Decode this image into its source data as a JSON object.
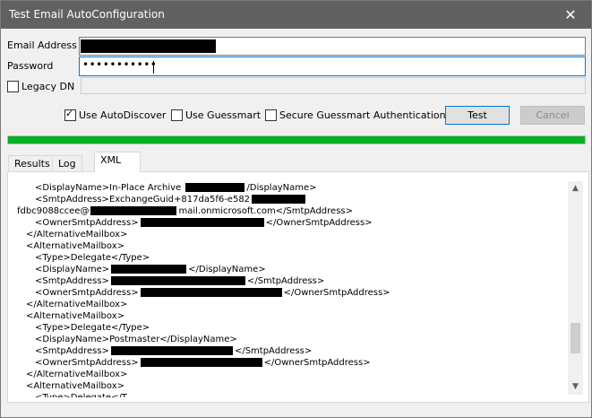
{
  "window": {
    "title": "Test Email AutoConfiguration",
    "close_glyph": "✕"
  },
  "form": {
    "email_label": "Email Address",
    "password_label": "Password",
    "password_value": "•••••••••••",
    "legacy_dn_label": "Legacy DN"
  },
  "options": {
    "use_autodiscover": {
      "label": "Use AutoDiscover",
      "checked": true
    },
    "use_guessmart": {
      "label": "Use Guessmart",
      "checked": false
    },
    "secure_guessmart": {
      "label": "Secure Guessmart Authentication",
      "checked": false
    }
  },
  "buttons": {
    "test": "Test",
    "cancel": "Cancel"
  },
  "progress": {
    "fraction": 1.0,
    "color": "#06b025"
  },
  "tabs": [
    {
      "label": "Results",
      "active": false
    },
    {
      "label": "Log",
      "active": false
    },
    {
      "label": "XML",
      "active": true
    }
  ],
  "xml_lines": [
    {
      "indent": 2,
      "before": "<DisplayName>In-Place Archive ",
      "after": "/DisplayName>"
    },
    {
      "indent": 2,
      "before": "<SmtpAddress>ExchangeGuid+817da5f6-e582",
      "after": ""
    },
    {
      "indent": 0,
      "before": "fdbc9088ccee@",
      "after": "mail.onmicrosoft.com</SmtpAddress>"
    },
    {
      "indent": 2,
      "before": "<OwnerSmtpAddress>",
      "after": "</OwnerSmtpAddress>"
    },
    {
      "indent": 1,
      "before": "</AlternativeMailbox>",
      "after": ""
    },
    {
      "indent": 1,
      "before": "<AlternativeMailbox>",
      "after": ""
    },
    {
      "indent": 2,
      "before": "<Type>Delegate</Type>",
      "after": ""
    },
    {
      "indent": 2,
      "before": "<DisplayName>",
      "after": "</DisplayName>"
    },
    {
      "indent": 2,
      "before": "<SmtpAddress>",
      "after": "</SmtpAddress>"
    },
    {
      "indent": 2,
      "before": "<OwnerSmtpAddress>",
      "after": "</OwnerSmtpAddress>"
    },
    {
      "indent": 1,
      "before": "</AlternativeMailbox>",
      "after": ""
    },
    {
      "indent": 1,
      "before": "<AlternativeMailbox>",
      "after": ""
    },
    {
      "indent": 2,
      "before": "<Type>Delegate</Type>",
      "after": ""
    },
    {
      "indent": 2,
      "before": "<DisplayName>Postmaster</DisplayName>",
      "after": ""
    },
    {
      "indent": 2,
      "before": "<SmtpAddress>",
      "after": "</SmtpAddress>"
    },
    {
      "indent": 2,
      "before": "<OwnerSmtpAddress>",
      "after": "</OwnerSmtpAddress>"
    },
    {
      "indent": 1,
      "before": "</AlternativeMailbox>",
      "after": ""
    },
    {
      "indent": 1,
      "before": "<AlternativeMailbox>",
      "after": ""
    },
    {
      "indent": 2,
      "before": "<Type>Delegate</T",
      "after": ""
    }
  ],
  "icons": {
    "scroll_up": "chevron-up-icon",
    "scroll_down": "chevron-down-icon",
    "check": "checkmark-icon"
  }
}
